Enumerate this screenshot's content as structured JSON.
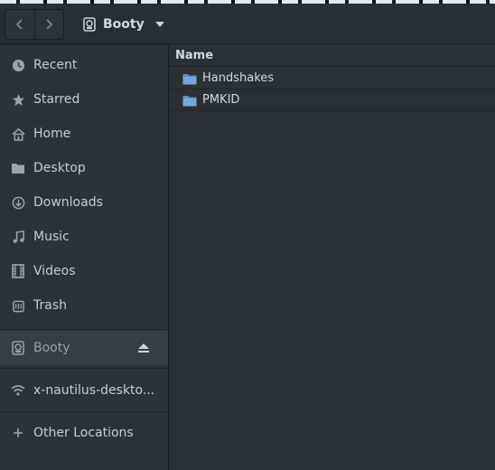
{
  "header": {
    "location": "Booty",
    "back_icon": "chevron-left-icon",
    "forward_icon": "chevron-right-icon"
  },
  "sidebar": {
    "items": [
      {
        "label": "Recent",
        "icon": "clock-icon"
      },
      {
        "label": "Starred",
        "icon": "star-icon"
      },
      {
        "label": "Home",
        "icon": "home-icon"
      },
      {
        "label": "Desktop",
        "icon": "folder-icon"
      },
      {
        "label": "Downloads",
        "icon": "download-icon"
      },
      {
        "label": "Music",
        "icon": "music-icon"
      },
      {
        "label": "Videos",
        "icon": "film-icon"
      },
      {
        "label": "Trash",
        "icon": "trash-icon"
      }
    ],
    "device": {
      "label": "Booty",
      "icon": "drive-icon"
    },
    "network": {
      "label": "x-nautilus-deskto...",
      "icon": "wifi-icon"
    },
    "other": {
      "label": "Other Locations",
      "icon": "plus-icon"
    }
  },
  "main": {
    "column_header": "Name",
    "files": [
      {
        "name": "Handshakes"
      },
      {
        "name": "PMKID"
      }
    ]
  },
  "colors": {
    "folder": "#6e9fd4",
    "background": "#2c3032"
  }
}
